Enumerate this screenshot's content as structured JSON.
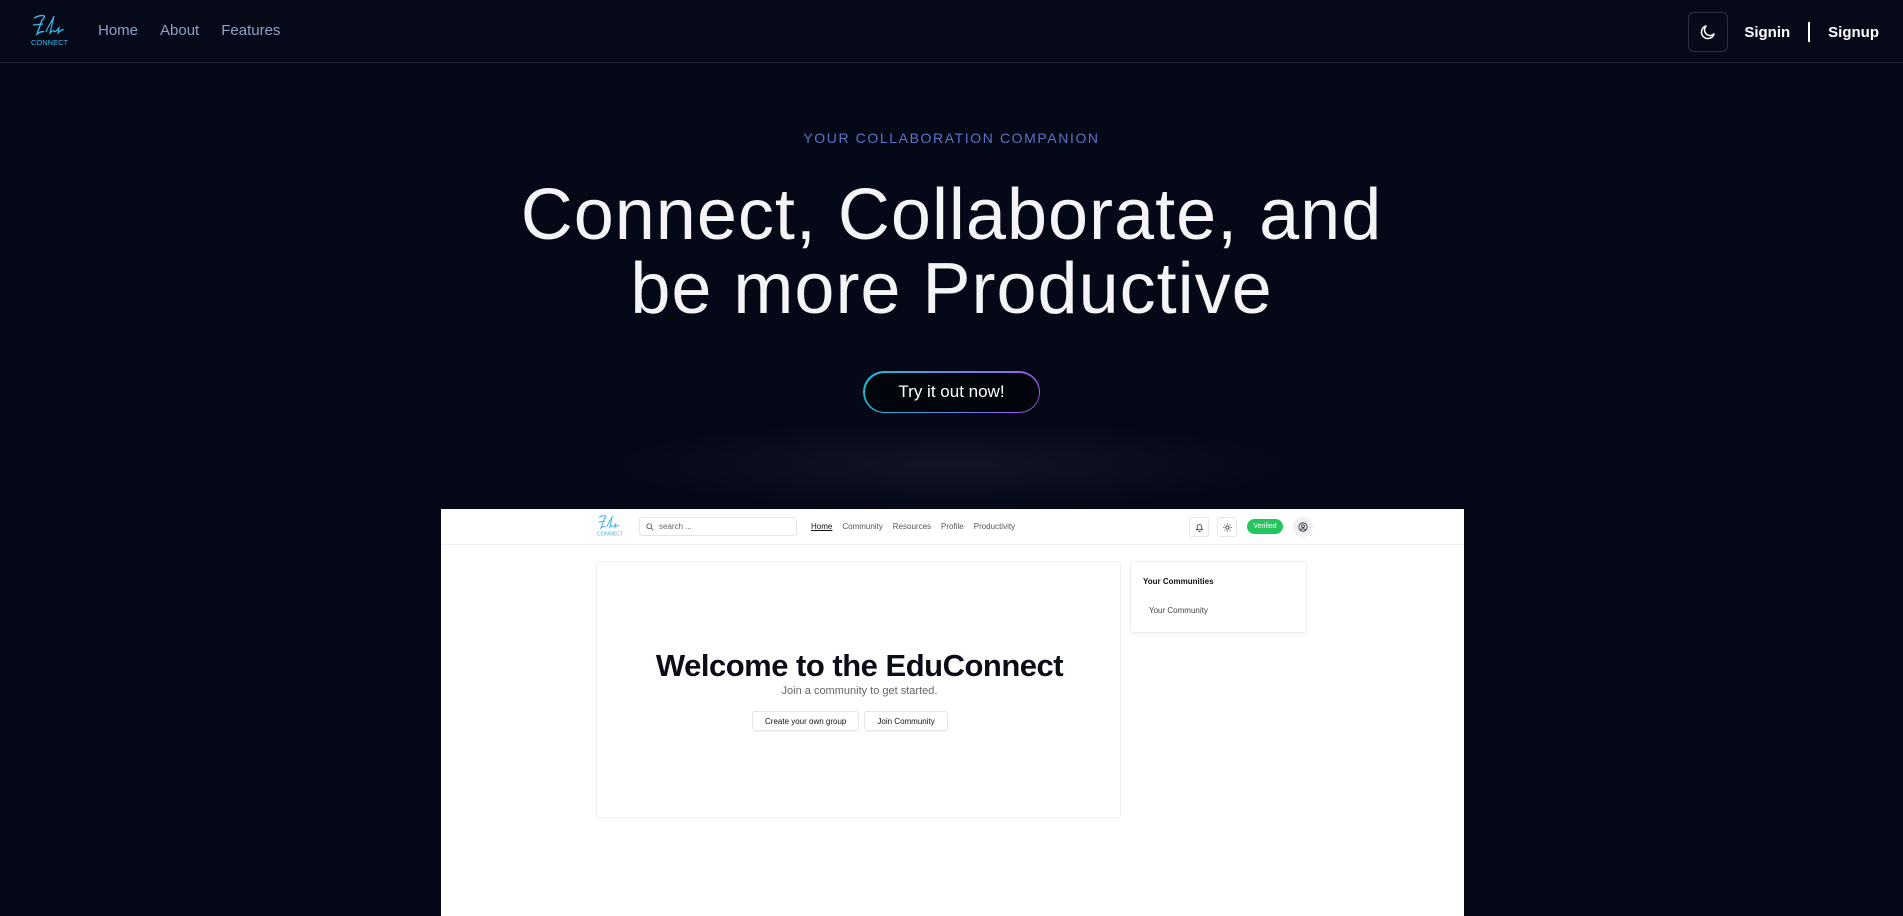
{
  "nav": {
    "logo_alt": "EduConnect logo",
    "links": [
      "Home",
      "About",
      "Features"
    ],
    "theme_icon": "moon-icon",
    "signin": "Signin",
    "signup": "Signup"
  },
  "hero": {
    "eyebrow": "YOUR COLLABORATION COMPANION",
    "headline_line1": "Connect, Collaborate, and",
    "headline_line2": "be more Productive",
    "cta": "Try it out now!"
  },
  "preview": {
    "search_placeholder": "search ...",
    "links": [
      "Home",
      "Community",
      "Resources",
      "Profile",
      "Productivity"
    ],
    "active_link": "Home",
    "verified": "Verified",
    "welcome_title": "Welcome to the EduConnect",
    "welcome_sub": "Join a community to get started.",
    "create_group": "Create your own group",
    "join_community": "Join Community",
    "communities_title": "Your Communities",
    "community_item": "Your Community"
  },
  "colors": {
    "background": "#050816",
    "eyebrow": "#5b75c9",
    "cta_gradient_start": "#22b8cf",
    "cta_gradient_end": "#a855f7",
    "verified_badge": "#22c55e"
  }
}
